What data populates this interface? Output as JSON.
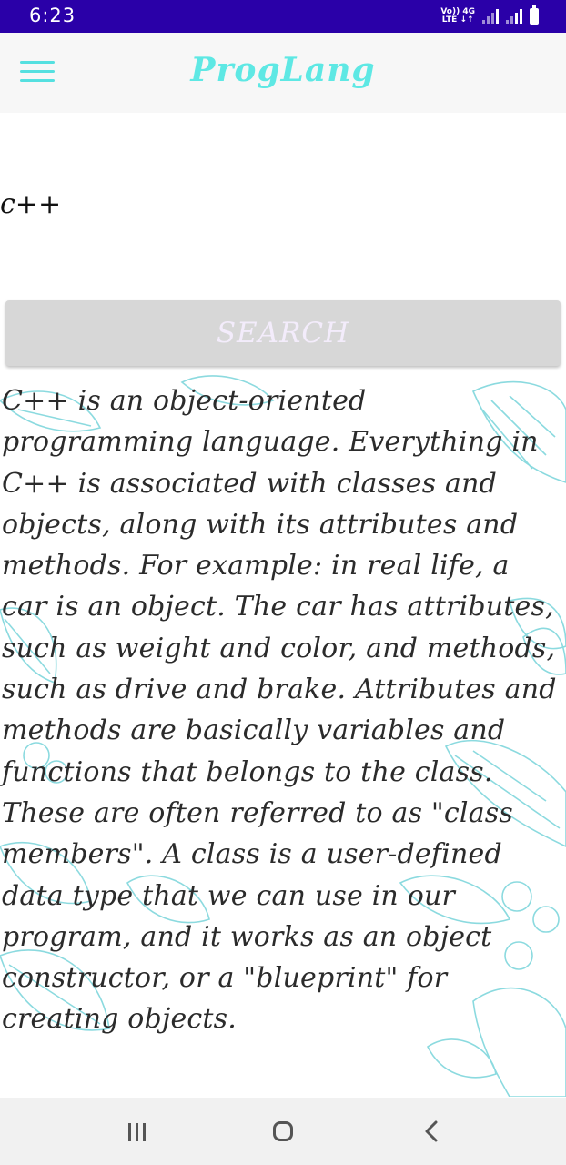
{
  "status_bar": {
    "time": "6:23",
    "network_label_top": "Vo)) 4G",
    "network_label_bottom": "LTE ↓↑",
    "icons": [
      "volte-icon",
      "signal-icon",
      "signal-icon",
      "battery-icon"
    ]
  },
  "app_bar": {
    "title": "ProgLang",
    "menu_icon": "hamburger-menu-icon"
  },
  "search": {
    "value": "c++",
    "placeholder": "",
    "button_label": "SEARCH"
  },
  "result": {
    "text": "C++ is an object-oriented programming language.  Everything in C++ is associated with classes and objects, along with its attributes and methods. For example: in real life, a car is an object. The car has attributes, such as weight and color, and methods, such as drive and brake.  Attributes and methods are basically variables and functions that belongs to the class. These are often referred to as \"class members\".  A class is a user-defined data type that we can use in our program, and it works as an object constructor, or a \"blueprint\" for creating objects."
  },
  "navigation": {
    "icons": [
      "recent-apps-icon",
      "home-icon",
      "back-icon"
    ]
  },
  "colors": {
    "status_bar": "#2a00a8",
    "accent": "#5ee8e4",
    "button_bg": "#d7d7d7",
    "button_text": "#f3ecfb",
    "decor_leaves": "#7fd6dc"
  }
}
